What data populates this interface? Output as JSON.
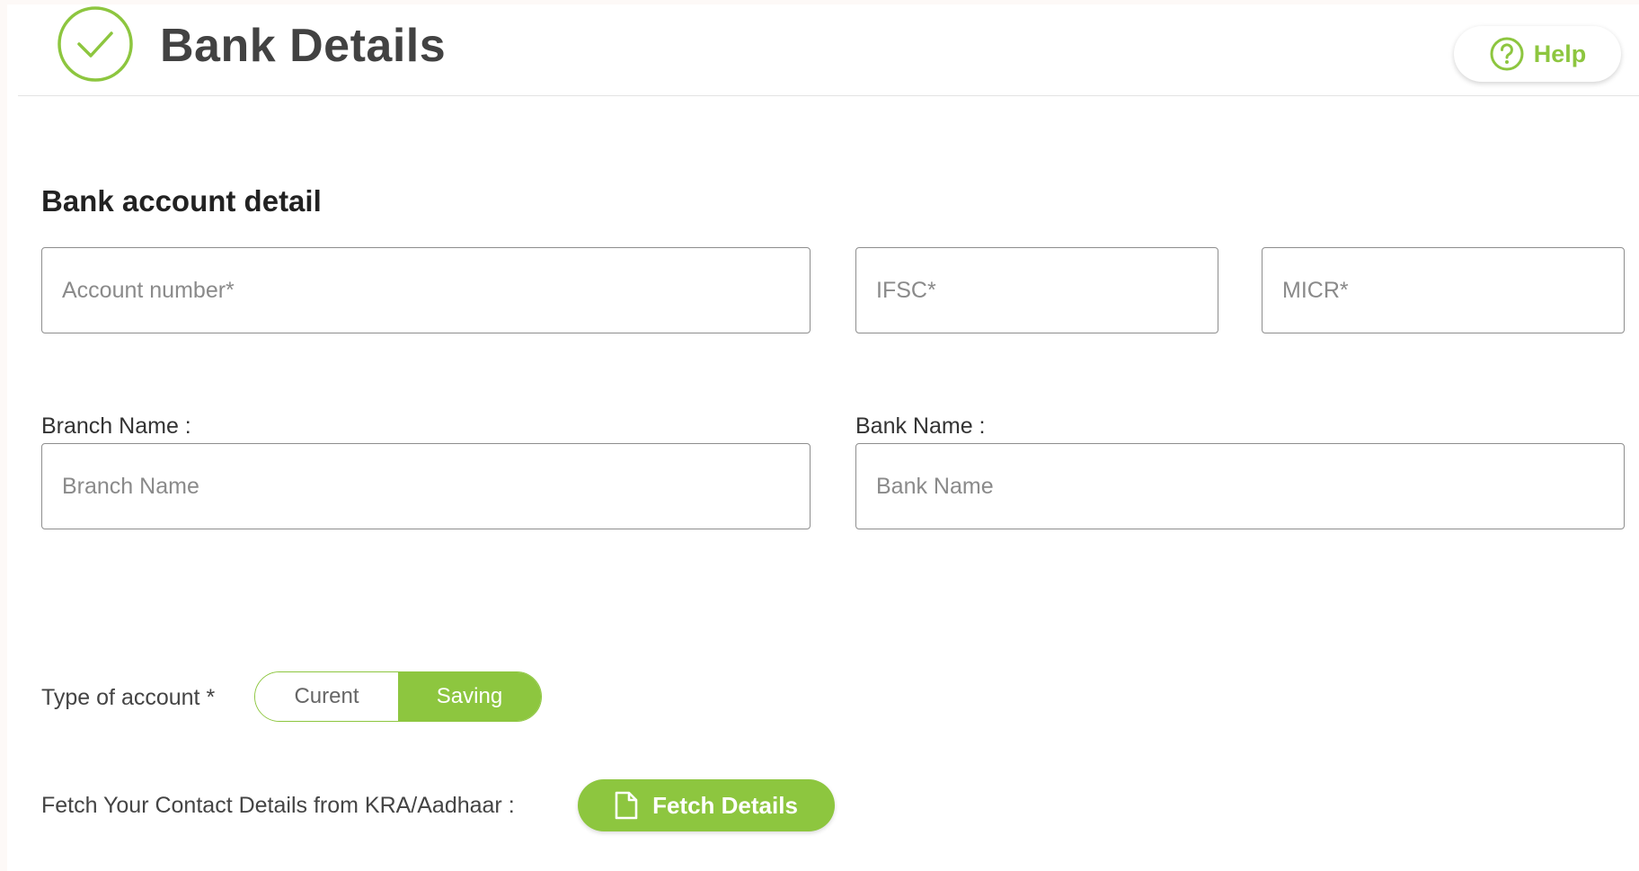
{
  "header": {
    "title": "Bank Details",
    "help_label": "Help"
  },
  "section": {
    "title": "Bank account detail"
  },
  "fields": {
    "account_number": {
      "placeholder": "Account number*",
      "value": ""
    },
    "ifsc": {
      "placeholder": "IFSC*",
      "value": ""
    },
    "micr": {
      "placeholder": "MICR*",
      "value": ""
    },
    "branch_name": {
      "label": "Branch Name :",
      "placeholder": "Branch Name",
      "value": ""
    },
    "bank_name": {
      "label": "Bank Name :",
      "placeholder": "Bank Name",
      "value": ""
    }
  },
  "account_type": {
    "label": "Type of account *",
    "options": [
      "Curent",
      "Saving"
    ],
    "selected": "Saving"
  },
  "fetch": {
    "label": "Fetch Your Contact Details from KRA/Aadhaar :",
    "button_label": "Fetch Details"
  },
  "icons": {
    "header": "check-circle-icon",
    "help": "question-circle-icon",
    "fetch": "document-icon"
  },
  "colors": {
    "accent": "#8dc63f",
    "title": "#424242",
    "border": "#8e8e8e"
  }
}
